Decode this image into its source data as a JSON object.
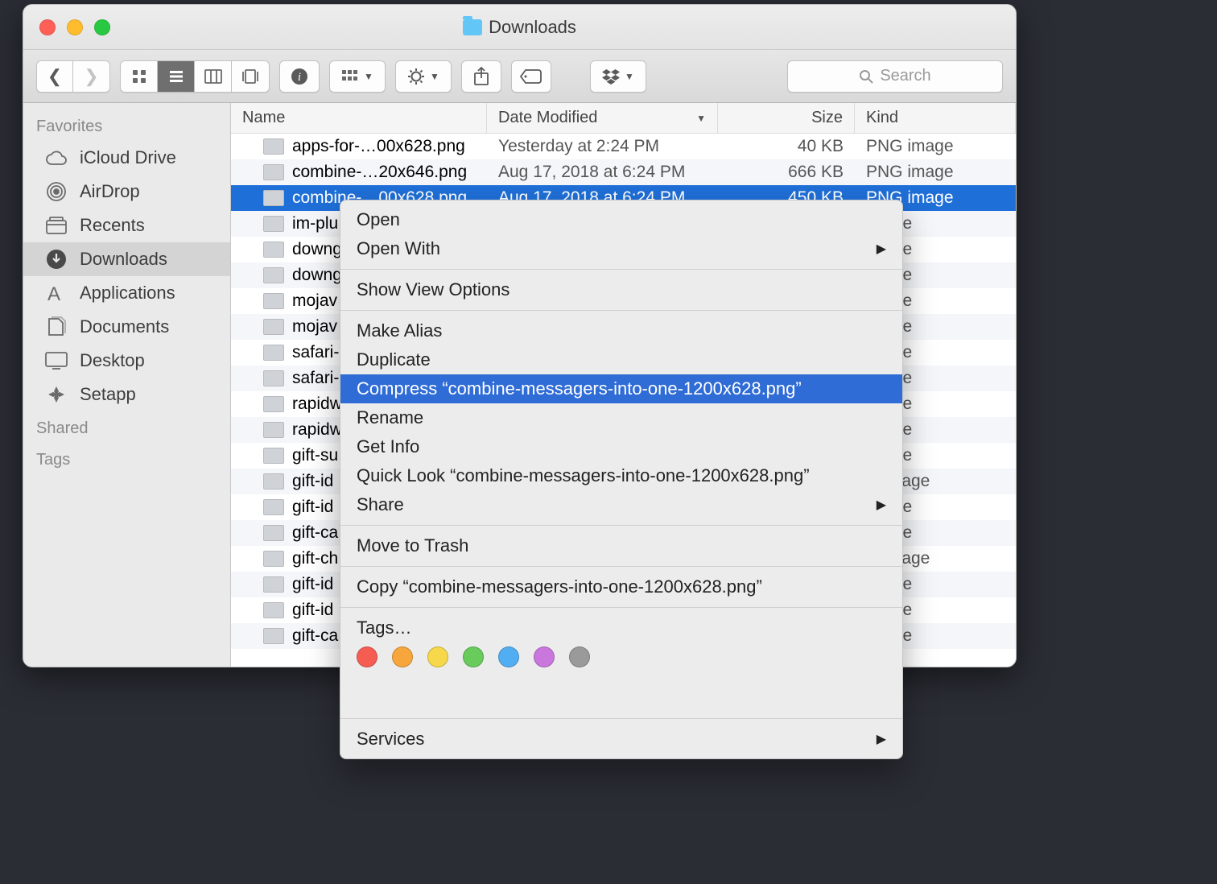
{
  "window": {
    "title": "Downloads"
  },
  "search": {
    "placeholder": "Search"
  },
  "sidebar": {
    "sections": [
      {
        "title": "Favorites",
        "items": [
          {
            "icon": "cloud",
            "label": "iCloud Drive"
          },
          {
            "icon": "airdrop",
            "label": "AirDrop"
          },
          {
            "icon": "recents",
            "label": "Recents"
          },
          {
            "icon": "downloads",
            "label": "Downloads",
            "active": true
          },
          {
            "icon": "apps",
            "label": "Applications"
          },
          {
            "icon": "docs",
            "label": "Documents"
          },
          {
            "icon": "desktop",
            "label": "Desktop"
          },
          {
            "icon": "setapp",
            "label": "Setapp"
          }
        ]
      },
      {
        "title": "Shared",
        "items": []
      },
      {
        "title": "Tags",
        "items": []
      }
    ]
  },
  "columns": {
    "name": "Name",
    "date": "Date Modified",
    "size": "Size",
    "kind": "Kind"
  },
  "files": [
    {
      "name": "apps-for-…00x628.png",
      "date": "Yesterday at 2:24 PM",
      "size": "40 KB",
      "kind": "PNG image"
    },
    {
      "name": "combine-…20x646.png",
      "date": "Aug 17, 2018 at 6:24 PM",
      "size": "666 KB",
      "kind": "PNG image"
    },
    {
      "name": "combine-…00x628.png",
      "date": "Aug 17, 2018 at 6:24 PM",
      "size": "450 KB",
      "kind": "PNG image",
      "selected": true
    },
    {
      "name": "im-plu",
      "kind": "image"
    },
    {
      "name": "downg",
      "kind": "image"
    },
    {
      "name": "downg",
      "kind": "image"
    },
    {
      "name": "mojav",
      "kind": "image"
    },
    {
      "name": "mojav",
      "kind": "image"
    },
    {
      "name": "safari-",
      "kind": "image"
    },
    {
      "name": "safari-",
      "kind": "image"
    },
    {
      "name": "rapidw",
      "kind": "image"
    },
    {
      "name": "rapidw",
      "kind": "image"
    },
    {
      "name": "gift-su",
      "kind": "image"
    },
    {
      "name": "gift-id",
      "kind": "G image"
    },
    {
      "name": "gift-id",
      "kind": "image"
    },
    {
      "name": "gift-ca",
      "kind": "image"
    },
    {
      "name": "gift-ch",
      "kind": "G image"
    },
    {
      "name": "gift-id",
      "kind": "image"
    },
    {
      "name": "gift-id",
      "kind": "image"
    },
    {
      "name": "gift-ca",
      "kind": "image"
    }
  ],
  "menu": {
    "open": "Open",
    "open_with": "Open With",
    "show_view": "Show View Options",
    "make_alias": "Make Alias",
    "duplicate": "Duplicate",
    "compress": "Compress “combine-messagers-into-one-1200x628.png”",
    "rename": "Rename",
    "get_info": "Get Info",
    "quick_look": "Quick Look “combine-messagers-into-one-1200x628.png”",
    "share": "Share",
    "trash": "Move to Trash",
    "copy": "Copy “combine-messagers-into-one-1200x628.png”",
    "tags_label": "Tags…",
    "services": "Services",
    "tag_colors": [
      "#f55d52",
      "#f7a63c",
      "#f7d84a",
      "#68cb5b",
      "#51aef2",
      "#c977dc",
      "#9a9a9a"
    ]
  }
}
